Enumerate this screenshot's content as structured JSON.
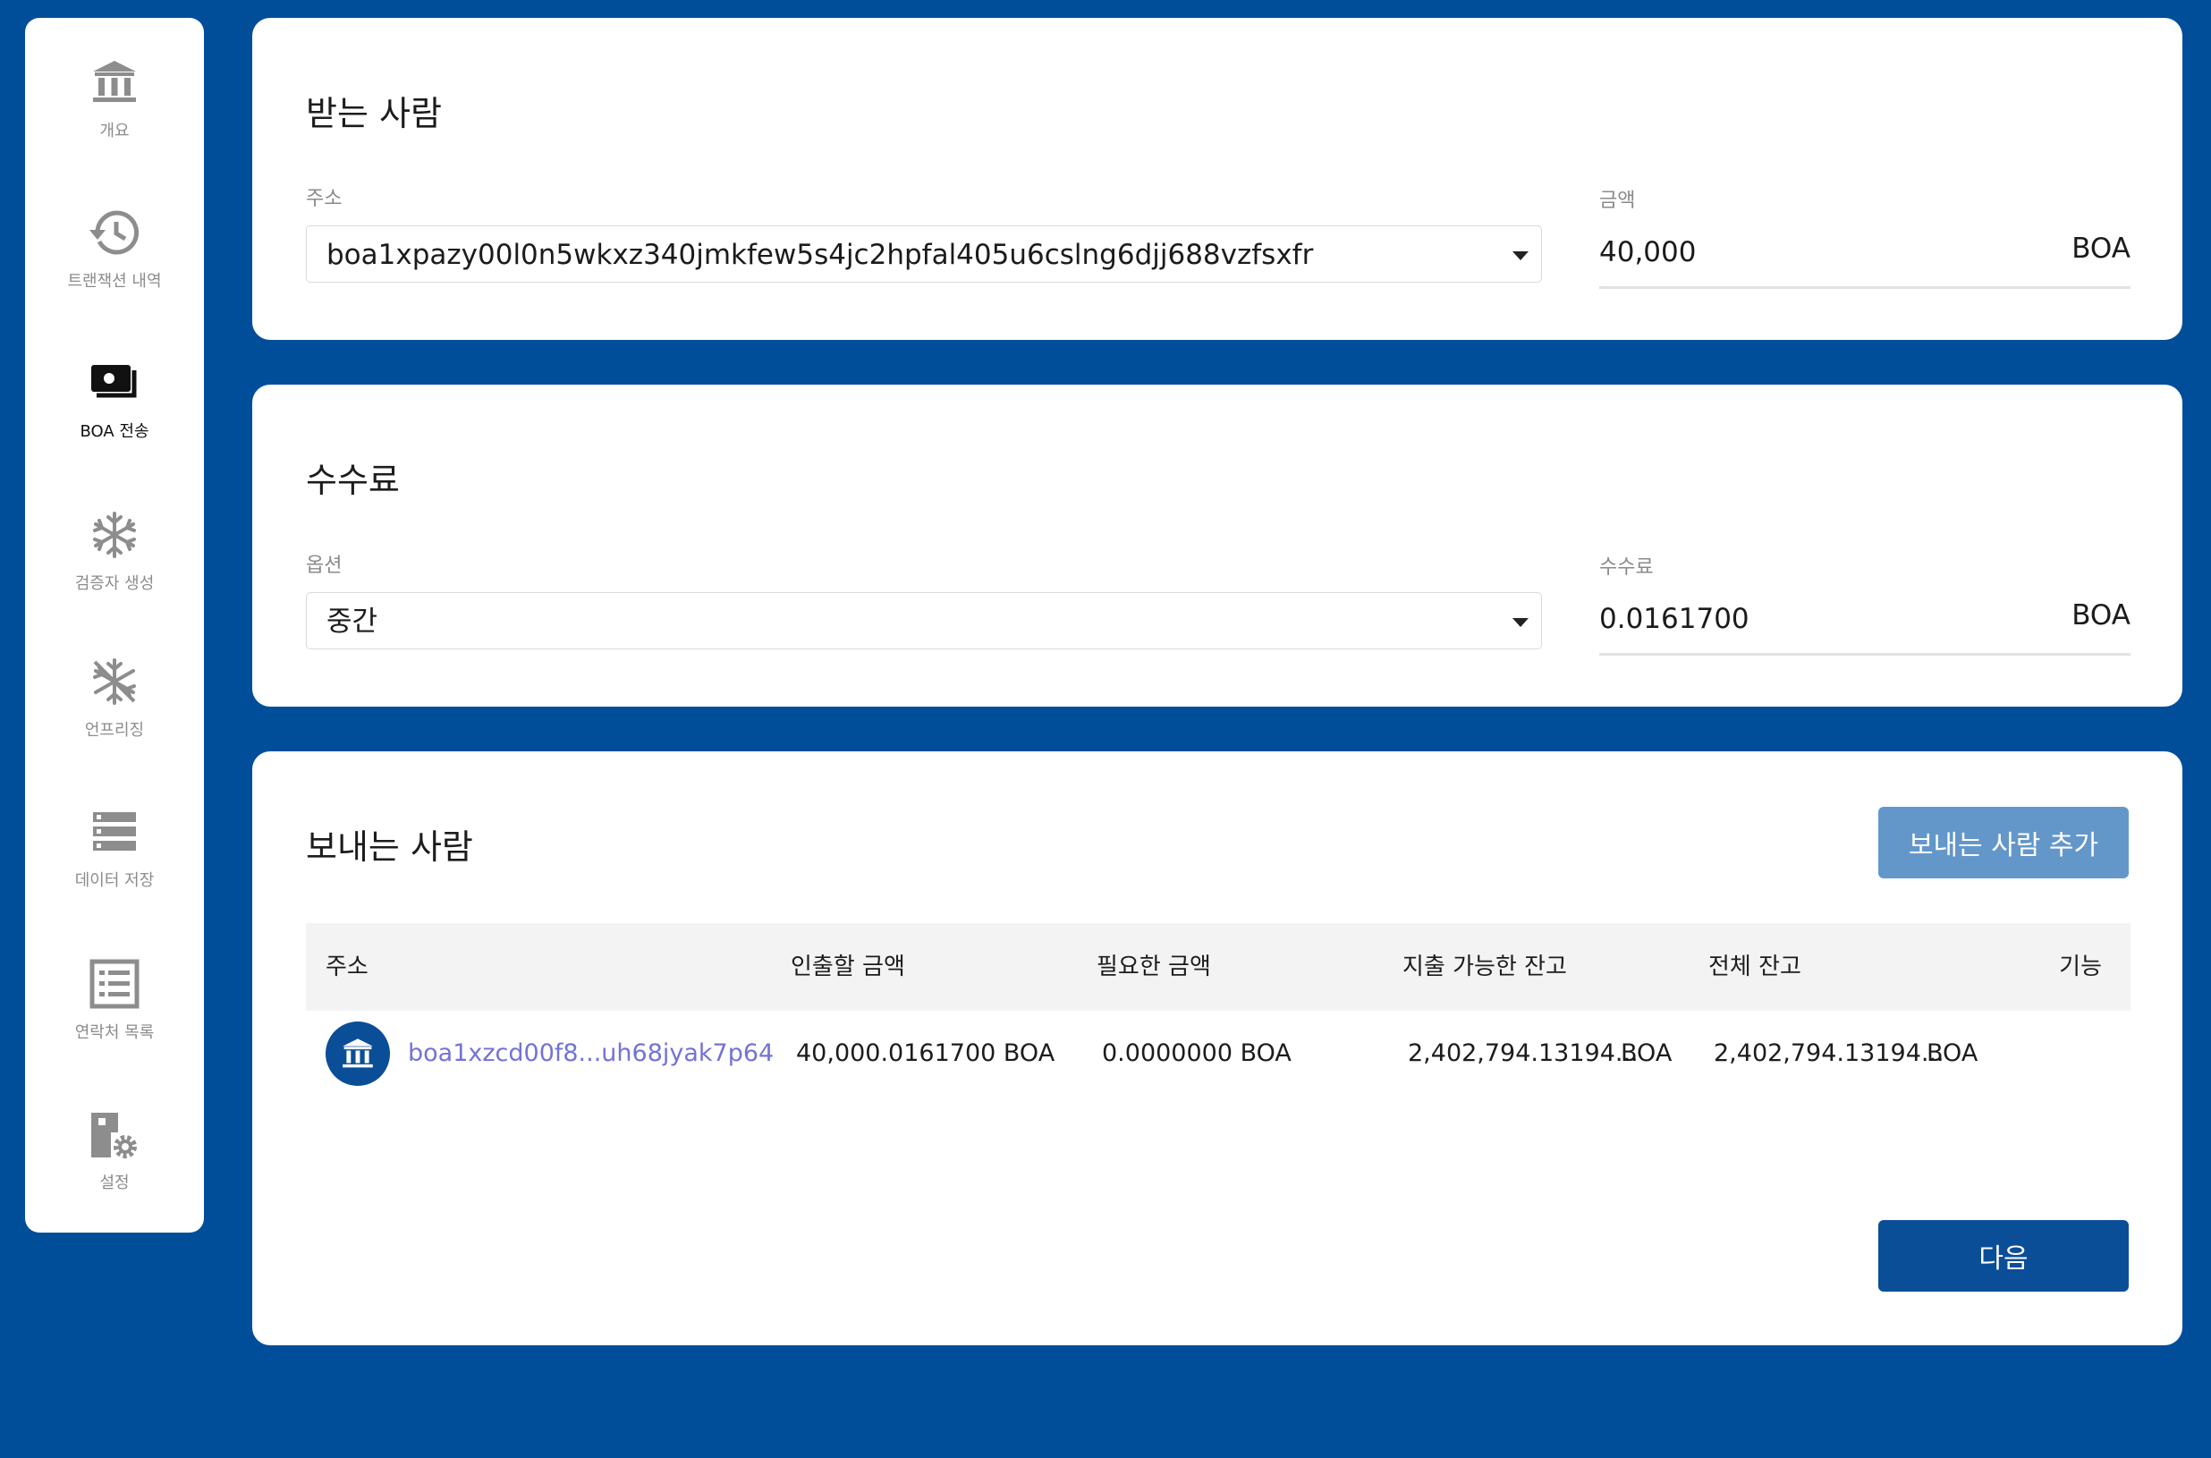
{
  "sidebar": {
    "items": [
      {
        "label": "개요",
        "icon": "bank-icon",
        "active": false
      },
      {
        "label": "트랜잭션 내역",
        "icon": "history-icon",
        "active": false
      },
      {
        "label": "BOA 전송",
        "icon": "money-icon",
        "active": true
      },
      {
        "label": "검증자 생성",
        "icon": "snowflake-icon",
        "active": false
      },
      {
        "label": "언프리징",
        "icon": "unfreeze-icon",
        "active": false
      },
      {
        "label": "데이터 저장",
        "icon": "storage-icon",
        "active": false
      },
      {
        "label": "연락처 목록",
        "icon": "list-icon",
        "active": false
      },
      {
        "label": "설정",
        "icon": "settings-icon",
        "active": false
      }
    ]
  },
  "recipient": {
    "title": "받는 사람",
    "address_label": "주소",
    "address_value": "boa1xpazy00l0n5wkxz340jmkfew5s4jc2hpfal405u6cslng6djj688vzfsxfr",
    "amount_label": "금액",
    "amount_value": "40,000",
    "amount_unit": "BOA"
  },
  "fee": {
    "title": "수수료",
    "option_label": "옵션",
    "option_value": "중간",
    "fee_label": "수수료",
    "fee_value": "0.0161700",
    "fee_unit": "BOA"
  },
  "sender": {
    "title": "보내는 사람",
    "add_button": "보내는 사람 추가",
    "columns": [
      "주소",
      "인출할 금액",
      "필요한 금액",
      "지출 가능한 잔고",
      "전체 잔고",
      "기능"
    ],
    "rows": [
      {
        "address": "boa1xzcd00f8...uh68jyak7p64",
        "withdraw": "40,000.0161700 BOA",
        "required": "0.0000000 BOA",
        "spendable_amount": "2,402,794.13194...",
        "spendable_unit": "BOA",
        "total_amount": "2,402,794.13194...",
        "total_unit": "BOA"
      }
    ],
    "next_button": "다음"
  },
  "colors": {
    "background": "#004e9a",
    "primary": "#0a4e97",
    "secondary_button": "#6397c9",
    "link": "#7372d6"
  }
}
